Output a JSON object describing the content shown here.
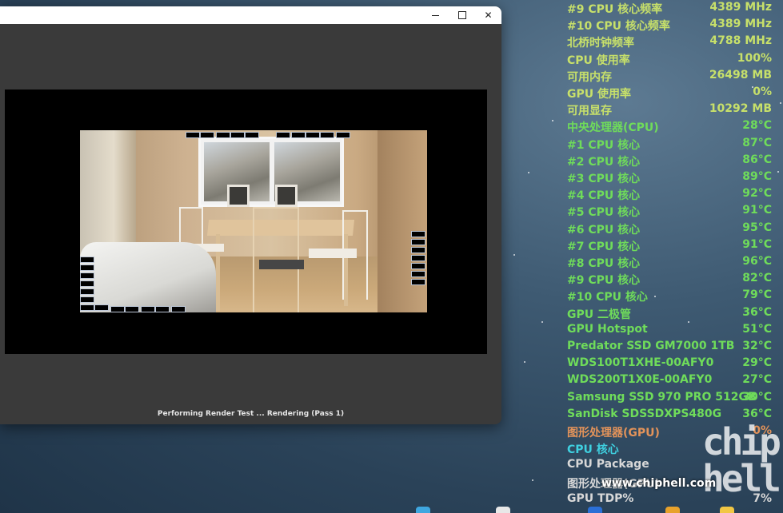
{
  "window": {
    "status": "Performing Render Test ... Rendering (Pass 1)",
    "minimize_icon": "minimize-icon",
    "maximize_icon": "maximize-icon",
    "close_icon": "close-icon"
  },
  "monitor": {
    "rows": [
      {
        "label": "#9 CPU 核心频率",
        "value": "4389 MHz",
        "color": "#c7e06a"
      },
      {
        "label": "#10 CPU 核心频率",
        "value": "4389 MHz",
        "color": "#c7e06a"
      },
      {
        "label": "北桥时钟频率",
        "value": "4788 MHz",
        "color": "#c7e06a"
      },
      {
        "label": "CPU 使用率",
        "value": "100%",
        "color": "#c7e06a"
      },
      {
        "label": "可用内存",
        "value": "26498 MB",
        "color": "#c7e06a"
      },
      {
        "label": "GPU 使用率",
        "value": "0%",
        "color": "#c7e06a"
      },
      {
        "label": "可用显存",
        "value": "10292 MB",
        "color": "#c7e06a"
      },
      {
        "label": "中央处理器(CPU)",
        "value": "28°C",
        "color": "#6fdc5a"
      },
      {
        "label": " #1 CPU 核心",
        "value": "87°C",
        "color": "#6fdc5a"
      },
      {
        "label": " #2 CPU 核心",
        "value": "86°C",
        "color": "#6fdc5a"
      },
      {
        "label": " #3 CPU 核心",
        "value": "89°C",
        "color": "#6fdc5a"
      },
      {
        "label": " #4 CPU 核心",
        "value": "92°C",
        "color": "#6fdc5a"
      },
      {
        "label": " #5 CPU 核心",
        "value": "91°C",
        "color": "#6fdc5a"
      },
      {
        "label": " #6 CPU 核心",
        "value": "95°C",
        "color": "#6fdc5a"
      },
      {
        "label": " #7 CPU 核心",
        "value": "91°C",
        "color": "#6fdc5a"
      },
      {
        "label": " #8 CPU 核心",
        "value": "96°C",
        "color": "#6fdc5a"
      },
      {
        "label": " #9 CPU 核心",
        "value": "82°C",
        "color": "#6fdc5a"
      },
      {
        "label": " #10 CPU 核心",
        "value": "79°C",
        "color": "#6fdc5a"
      },
      {
        "label": "GPU 二极管",
        "value": "36°C",
        "color": "#6fdc5a"
      },
      {
        "label": "GPU Hotspot",
        "value": "51°C",
        "color": "#6fdc5a"
      },
      {
        "label": "Predator SSD GM7000 1TB",
        "value": "32°C",
        "color": "#6fdc5a"
      },
      {
        "label": "WDS100T1XHE-00AFY0",
        "value": "29°C",
        "color": "#6fdc5a"
      },
      {
        "label": "WDS200T1X0E-00AFY0",
        "value": "27°C",
        "color": "#6fdc5a"
      },
      {
        "label": "Samsung SSD 970 PRO 512GB",
        "value": "30°C",
        "color": "#6fdc5a"
      },
      {
        "label": "SanDisk SDSSDXPS480G",
        "value": "36°C",
        "color": "#6fdc5a"
      },
      {
        "label": "图形处理器(GPU)",
        "value": "0%",
        "color": "#e3935a"
      },
      {
        "label": "CPU 核心",
        "value": "",
        "color": "#3fd0e0"
      },
      {
        "label": "CPU Package",
        "value": "",
        "color": "#d8d8d8"
      },
      {
        "label": "图形处理器(GPU)",
        "value": "",
        "color": "#d8d8d8"
      },
      {
        "label": "GPU TDP%",
        "value": "7%",
        "color": "#d8d8d8"
      }
    ]
  },
  "watermark": {
    "url": "www.chiphell.com",
    "logo": "chip hell"
  }
}
